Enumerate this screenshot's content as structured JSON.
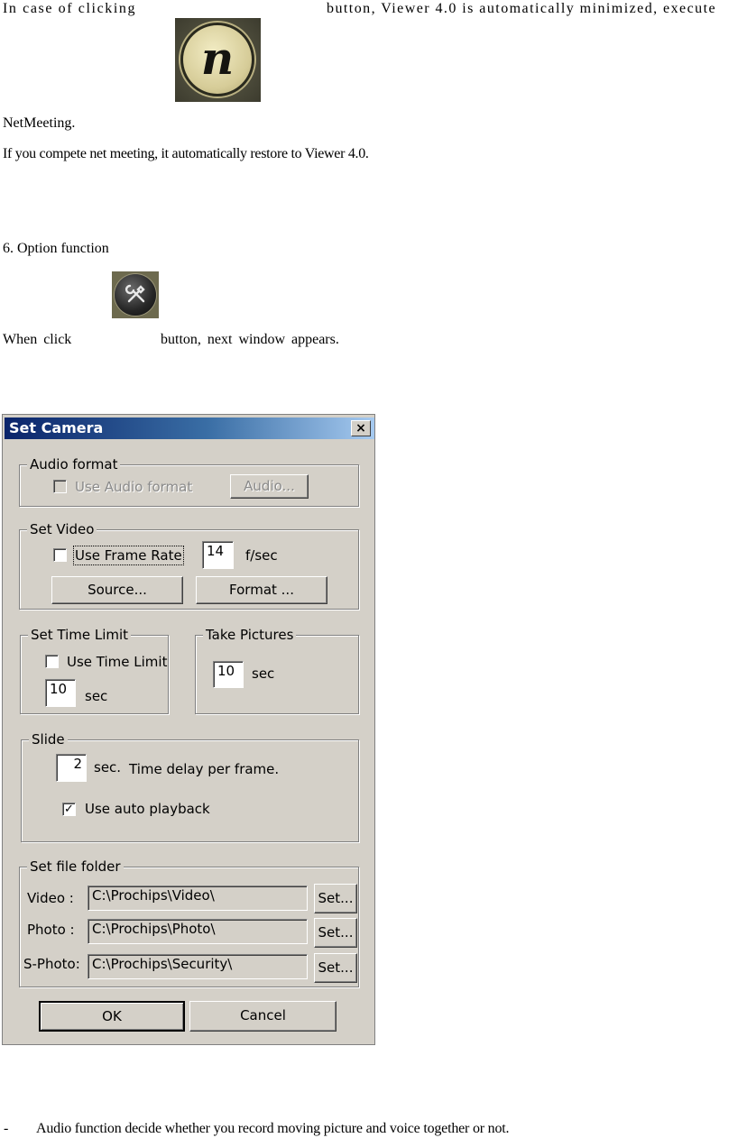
{
  "doc": {
    "line1_a": "In case of clicking",
    "line1_b": "button, Viewer 4.0 is automatically minimized, execute",
    "line2": "NetMeeting.",
    "line3": "If you compete net meeting, it automatically restore to Viewer 4.0.",
    "heading": "6. Option function",
    "line4_a": "When click",
    "line4_b": "button, next window appears.",
    "bullet_dash": "-",
    "bullet_text": "Audio function decide whether you record moving picture and voice together or not.",
    "netmeeting_icon": {
      "icon": "netmeeting-icon",
      "glyph": "n"
    },
    "option_icon": {
      "icon": "tools-icon"
    }
  },
  "dialog": {
    "title": "Set Camera",
    "close_label": "×",
    "audio": {
      "legend": "Audio format",
      "checkbox_label": "Use Audio format",
      "checked": false,
      "enabled": false,
      "button": "Audio..."
    },
    "video": {
      "legend": "Set Video",
      "checkbox_label": "Use Frame Rate",
      "checked": false,
      "rate_value": "14",
      "rate_unit": "f/sec",
      "source_button": "Source...",
      "format_button": "Format ..."
    },
    "time_limit": {
      "legend": "Set Time Limit",
      "checkbox_label": "Use Time Limit",
      "checked": false,
      "value": "10",
      "unit": "sec"
    },
    "pictures": {
      "legend": "Take Pictures",
      "value": "10",
      "unit": "sec"
    },
    "slide": {
      "legend": "Slide",
      "value": "2",
      "unit": "sec.",
      "desc": "Time delay per frame.",
      "auto_label": "Use auto playback",
      "auto_checked": true,
      "check_mark": "✓"
    },
    "folder": {
      "legend": "Set file folder",
      "rows": [
        {
          "label": "Video :",
          "path": "C:\\Prochips\\Video\\",
          "button": "Set..."
        },
        {
          "label": "Photo :",
          "path": "C:\\Prochips\\Photo\\",
          "button": "Set..."
        },
        {
          "label": "S-Photo:",
          "path": "C:\\Prochips\\Security\\",
          "button": "Set..."
        }
      ]
    },
    "ok_button": "OK",
    "cancel_button": "Cancel"
  }
}
